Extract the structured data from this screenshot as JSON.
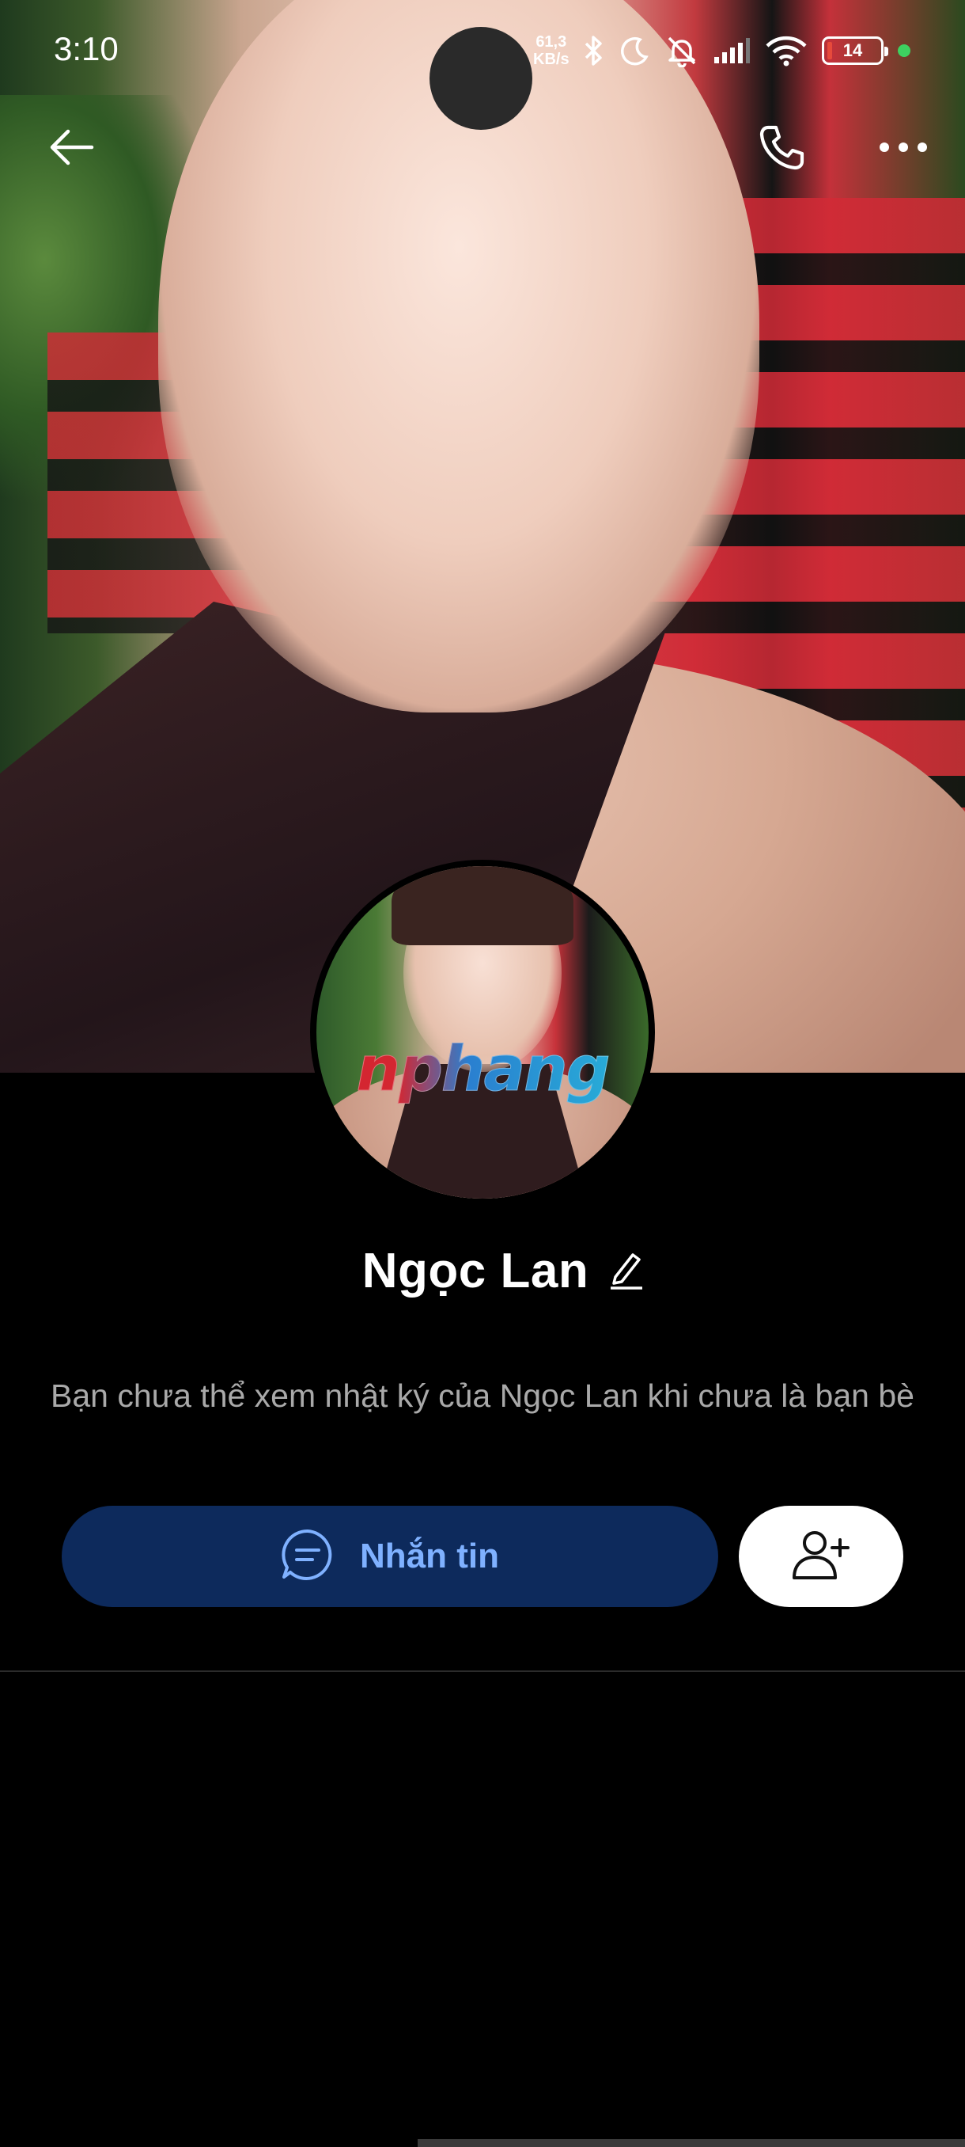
{
  "status_bar": {
    "time": "3:10",
    "net_speed_value": "61,3",
    "net_speed_unit": "KB/s",
    "battery_level": "14",
    "icons": [
      "bluetooth-icon",
      "moon-icon",
      "bell-off-icon",
      "signal-icon",
      "wifi-icon",
      "battery-icon"
    ]
  },
  "header": {
    "back_icon": "arrow-left-icon",
    "call_icon": "phone-icon",
    "more_icon": "more-horizontal-icon"
  },
  "profile": {
    "name": "Ngọc Lan",
    "avatar_watermark": "nphang",
    "notice": "Bạn chưa thể xem nhật ký của Ngọc Lan khi chưa là bạn bè"
  },
  "actions": {
    "message_label": "Nhắn tin",
    "message_icon": "chat-bubble-icon",
    "add_friend_icon": "user-plus-icon"
  },
  "colors": {
    "background": "#000000",
    "message_button_bg": "#0d2a5c",
    "message_button_text": "#7fb1ff",
    "notice_text": "#a9a9a9"
  }
}
